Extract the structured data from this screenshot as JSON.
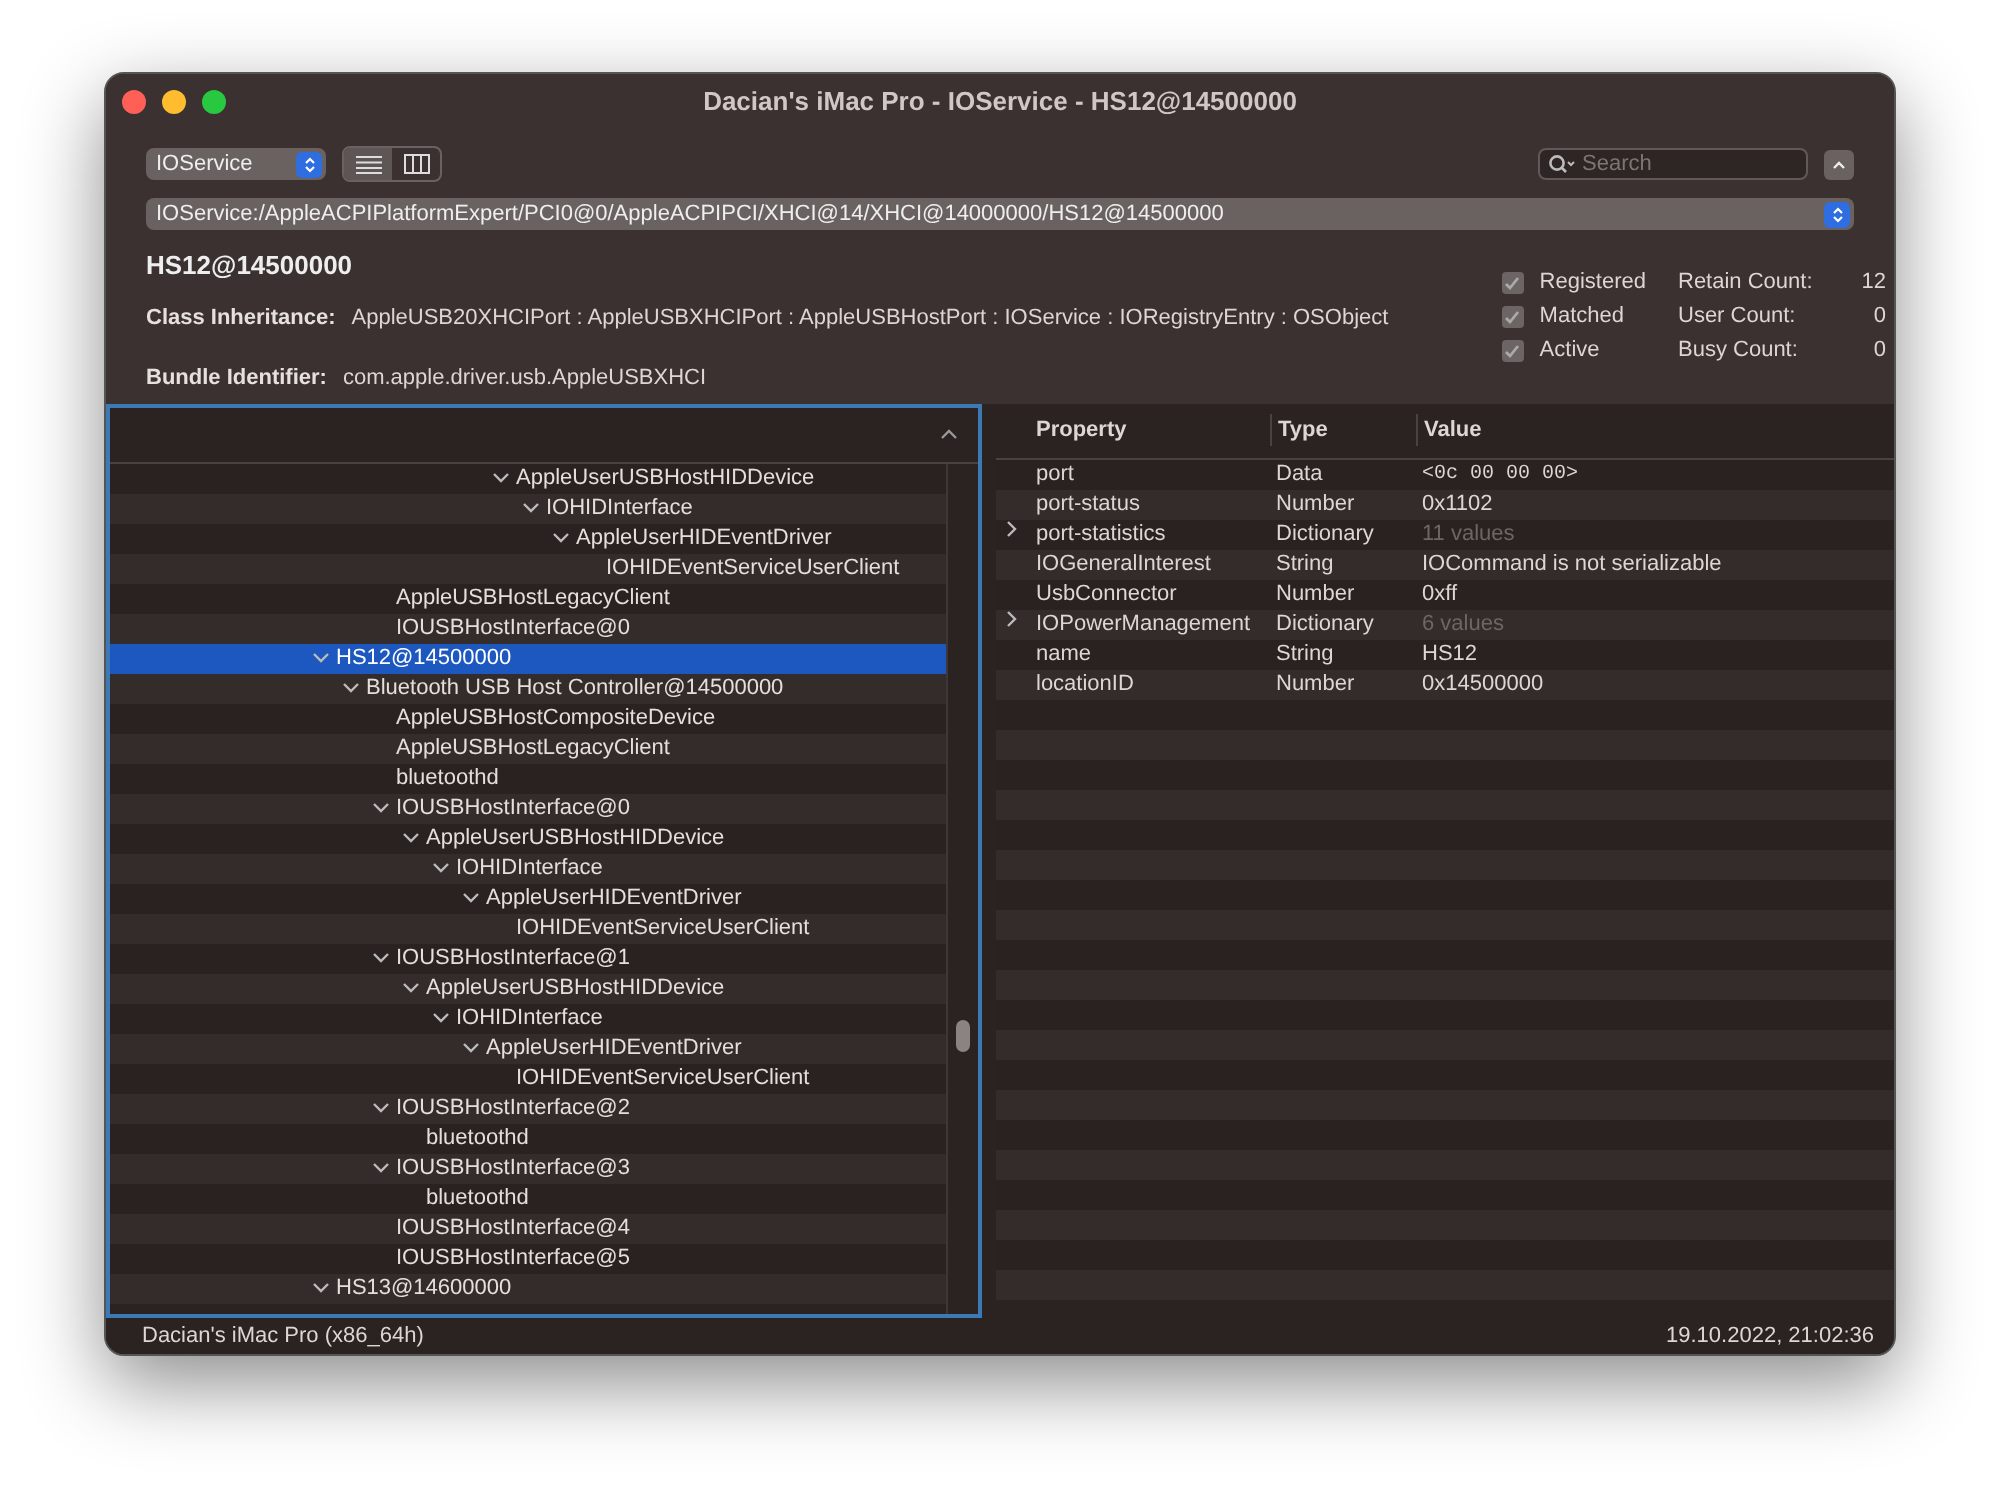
{
  "window": {
    "title": "Dacian's iMac Pro - IOService - HS12@14500000"
  },
  "toolbar": {
    "plane": "IOService",
    "views": [
      {
        "kind": "list",
        "selected": true
      },
      {
        "kind": "columns",
        "selected": false
      }
    ],
    "search": {
      "placeholder": "Search"
    }
  },
  "path": "IOService:/AppleACPIPlatformExpert/PCI0@0/AppleACPIPCI/XHCI@14/XHCI@14000000/HS12@14500000",
  "details": {
    "name": "HS12@14500000",
    "class_label": "Class Inheritance:",
    "class_value": "AppleUSB20XHCIPort : AppleUSBXHCIPort : AppleUSBHostPort : IOService : IORegistryEntry : OSObject",
    "bundle_label": "Bundle Identifier:",
    "bundle_value": "com.apple.driver.usb.AppleUSBXHCI",
    "flags": [
      {
        "label": "Registered",
        "checked": true
      },
      {
        "label": "Matched",
        "checked": true
      },
      {
        "label": "Active",
        "checked": true
      }
    ],
    "counts": [
      {
        "label": "Retain Count:",
        "value": "12"
      },
      {
        "label": "User Count:",
        "value": "0"
      },
      {
        "label": "Busy Count:",
        "value": "0"
      }
    ]
  },
  "tree": [
    {
      "children": [
        {
          "children": [
            {
              "children": [
                {
                  "children": [
                    {
                      "children": [
                        {
                          "children": [
                            {
                              "label": "AppleUserUSBHostHIDDevice",
                              "expanded": true,
                              "selected": false,
                              "children": [
                                {
                                  "label": "IOHIDInterface",
                                  "expanded": true,
                                  "selected": false,
                                  "children": [
                                    {
                                      "label": "AppleUserHIDEventDriver",
                                      "expanded": true,
                                      "selected": false,
                                      "children": [
                                        {
                                          "label": "IOHIDEventServiceUserClient",
                                          "selected": false
                                        }
                                      ]
                                    }
                                  ]
                                }
                              ]
                            }
                          ]
                        }
                      ]
                    }
                  ]
                }
              ]
            },
            {
              "label": "AppleUSBHostLegacyClient",
              "selected": false
            },
            {
              "label": "IOUSBHostInterface@0",
              "selected": false
            }
          ]
        }
      ]
    },
    {
      "label": "HS12@14500000",
      "expanded": true,
      "selected": true,
      "children": [
        {
          "label": "Bluetooth USB Host Controller@14500000",
          "expanded": true,
          "selected": false,
          "children": [
            {
              "label": "AppleUSBHostCompositeDevice",
              "selected": false
            },
            {
              "label": "AppleUSBHostLegacyClient",
              "selected": false
            },
            {
              "label": "bluetoothd",
              "selected": false
            },
            {
              "label": "IOUSBHostInterface@0",
              "expanded": true,
              "selected": false,
              "children": [
                {
                  "label": "AppleUserUSBHostHIDDevice",
                  "expanded": true,
                  "selected": false,
                  "children": [
                    {
                      "label": "IOHIDInterface",
                      "expanded": true,
                      "selected": false,
                      "children": [
                        {
                          "label": "AppleUserHIDEventDriver",
                          "expanded": true,
                          "selected": false,
                          "children": [
                            {
                              "label": "IOHIDEventServiceUserClient",
                              "selected": false
                            }
                          ]
                        }
                      ]
                    }
                  ]
                }
              ]
            },
            {
              "label": "IOUSBHostInterface@1",
              "expanded": true,
              "selected": false,
              "children": [
                {
                  "label": "AppleUserUSBHostHIDDevice",
                  "expanded": true,
                  "selected": false,
                  "children": [
                    {
                      "label": "IOHIDInterface",
                      "expanded": true,
                      "selected": false,
                      "children": [
                        {
                          "label": "AppleUserHIDEventDriver",
                          "expanded": true,
                          "selected": false,
                          "children": [
                            {
                              "label": "IOHIDEventServiceUserClient",
                              "selected": false
                            }
                          ]
                        }
                      ]
                    }
                  ]
                }
              ]
            },
            {
              "label": "IOUSBHostInterface@2",
              "expanded": true,
              "selected": false,
              "children": [
                {
                  "label": "bluetoothd",
                  "selected": false
                }
              ]
            },
            {
              "label": "IOUSBHostInterface@3",
              "expanded": true,
              "selected": false,
              "children": [
                {
                  "label": "bluetoothd",
                  "selected": false
                }
              ]
            },
            {
              "label": "IOUSBHostInterface@4",
              "selected": false
            },
            {
              "label": "IOUSBHostInterface@5",
              "selected": false
            }
          ]
        }
      ]
    },
    {
      "label": "HS13@14600000",
      "expanded": true,
      "selected": false
    }
  ],
  "properties": {
    "columns": [
      "Property",
      "Type",
      "Value"
    ],
    "rows": [
      {
        "property": "port",
        "type": "Data",
        "value": "<0c 00 00 00>",
        "kind": "data"
      },
      {
        "property": "port-status",
        "type": "Number",
        "value": "0x1102",
        "kind": "plain"
      },
      {
        "property": "port-statistics",
        "type": "Dictionary",
        "value": "11 values",
        "kind": "collection",
        "expanded": false
      },
      {
        "property": "IOGeneralInterest",
        "type": "String",
        "value": "IOCommand is not serializable",
        "kind": "plain"
      },
      {
        "property": "UsbConnector",
        "type": "Number",
        "value": "0xff",
        "kind": "plain"
      },
      {
        "property": "IOPowerManagement",
        "type": "Dictionary",
        "value": "6 values",
        "kind": "collection",
        "expanded": false
      },
      {
        "property": "name",
        "type": "String",
        "value": "HS12",
        "kind": "plain"
      },
      {
        "property": "locationID",
        "type": "Number",
        "value": "0x14500000",
        "kind": "plain"
      }
    ]
  },
  "status_bar": {
    "machine": "Dacian's iMac Pro (x86_64h)",
    "timestamp": "19.10.2022, 21:02:36"
  }
}
